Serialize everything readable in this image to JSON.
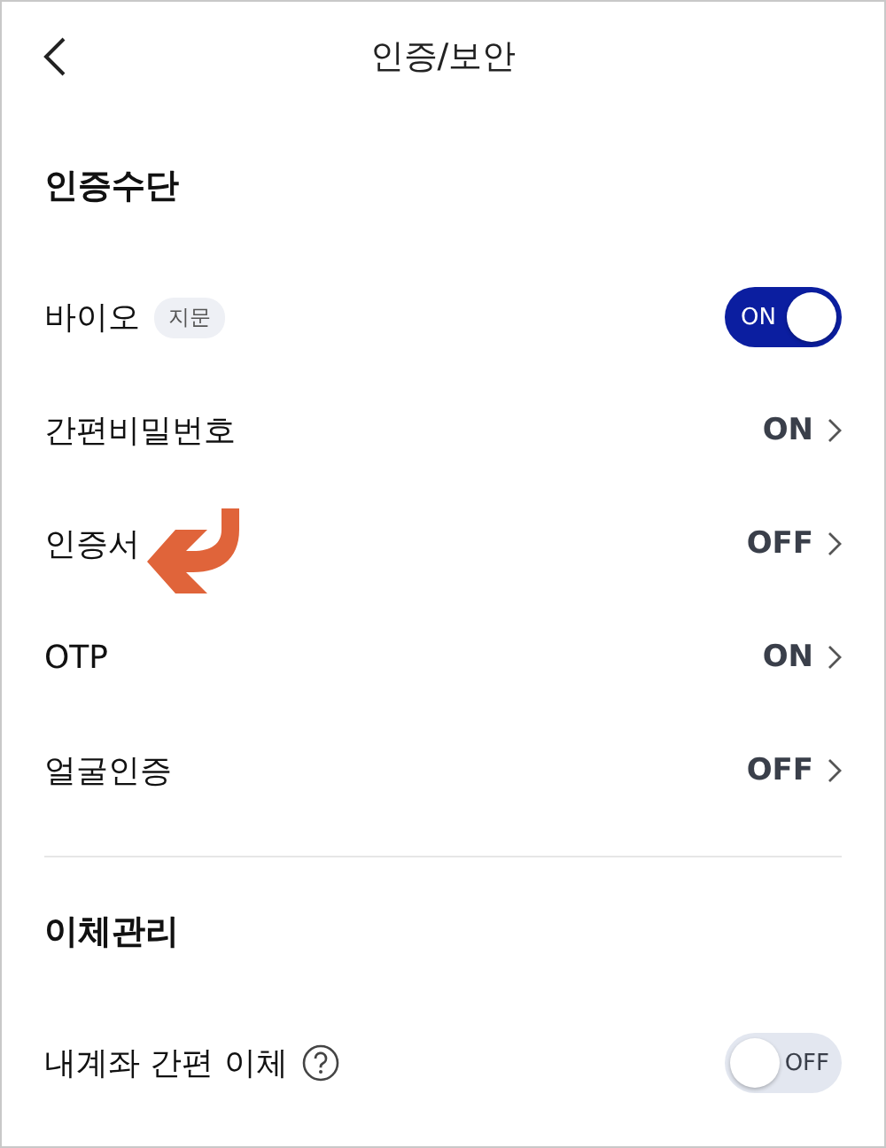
{
  "header": {
    "title": "인증/보안"
  },
  "sections": [
    {
      "title": "인증수단",
      "rows": [
        {
          "kind": "toggle",
          "label": "바이오",
          "tag": "지문",
          "on": true,
          "state_text": "ON"
        },
        {
          "kind": "link",
          "label": "간편비밀번호",
          "value": "ON"
        },
        {
          "kind": "link",
          "label": "인증서",
          "value": "OFF",
          "annotated": true
        },
        {
          "kind": "link",
          "label": "OTP",
          "value": "ON"
        },
        {
          "kind": "link",
          "label": "얼굴인증",
          "value": "OFF"
        }
      ]
    },
    {
      "title": "이체관리",
      "rows": [
        {
          "kind": "toggle",
          "label": "내계좌 간편 이체",
          "help": true,
          "on": false,
          "state_text": "OFF"
        }
      ]
    }
  ]
}
